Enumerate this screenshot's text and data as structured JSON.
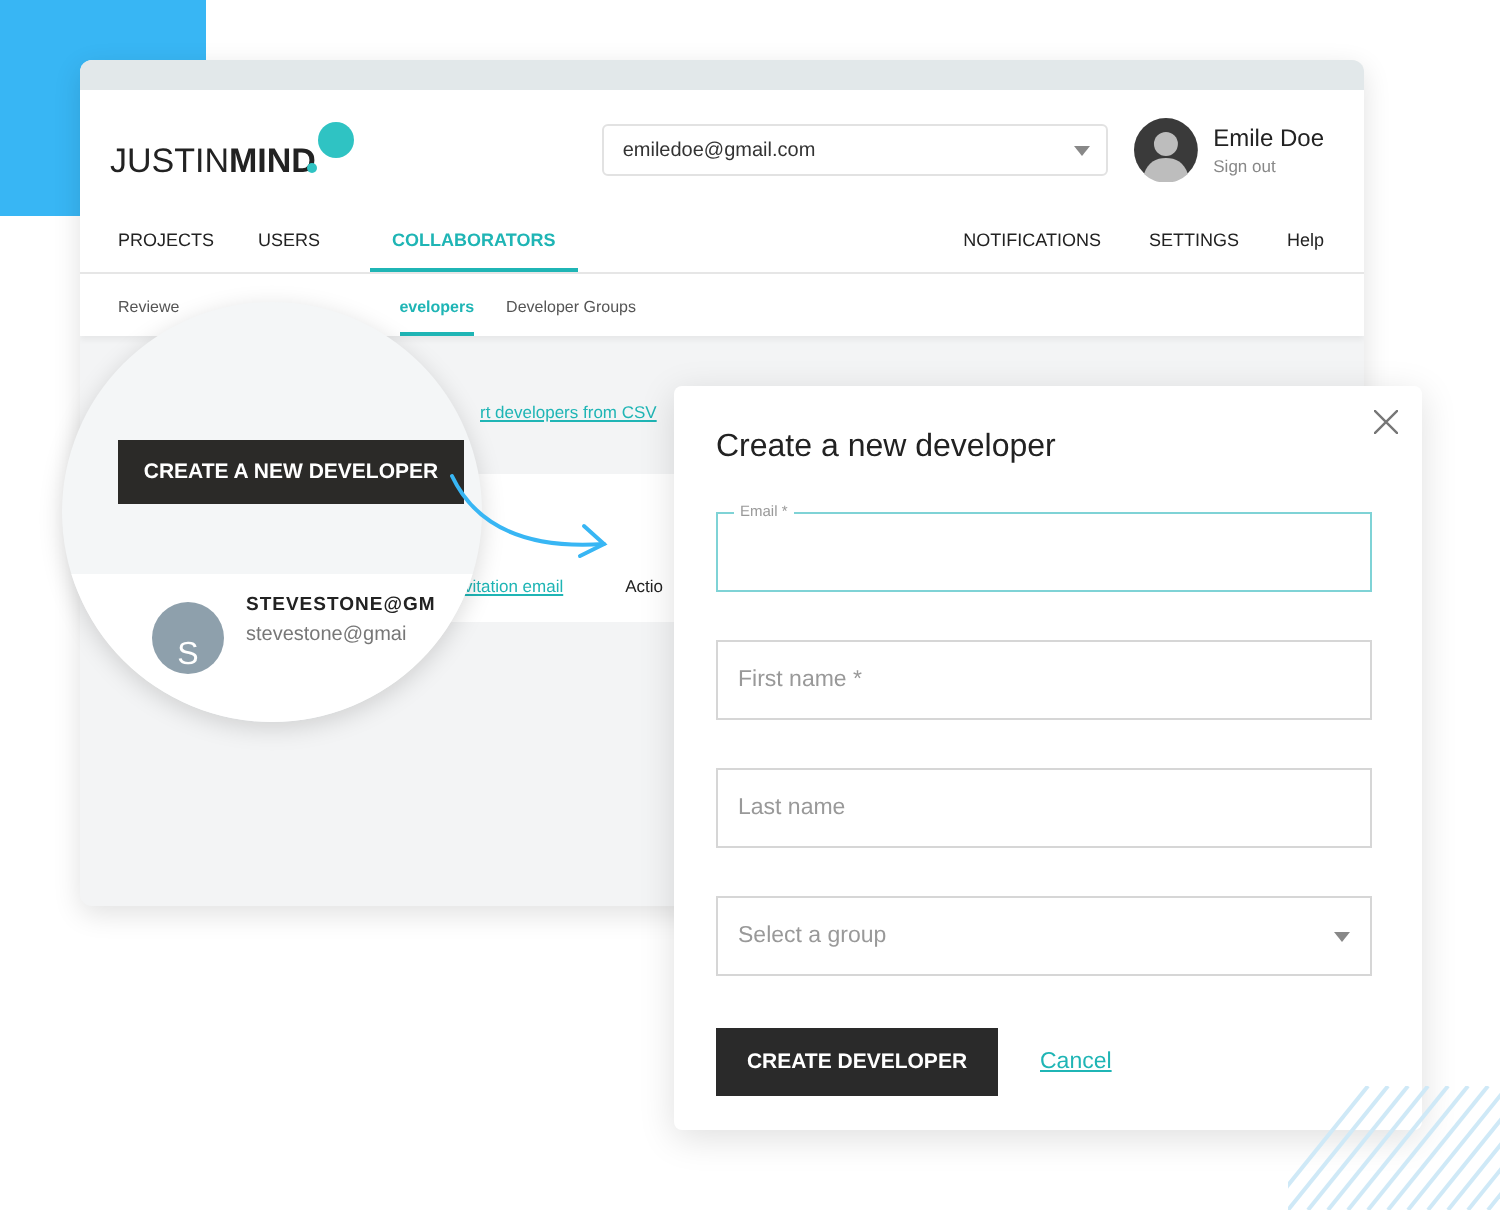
{
  "header": {
    "logo": {
      "light": "JUSTIN",
      "bold": "MIND"
    },
    "account_select": {
      "value": "emiledoe@gmail.com"
    },
    "user": {
      "name": "Emile Doe",
      "sign_out": "Sign out"
    }
  },
  "nav": {
    "left": [
      {
        "label": "PROJECTS",
        "selected": false
      },
      {
        "label": "USERS",
        "selected": false
      },
      {
        "label": "COLLABORATORS",
        "selected": true
      }
    ],
    "right": [
      {
        "label": "NOTIFICATIONS",
        "selected": false
      },
      {
        "label": "SETTINGS",
        "selected": false
      },
      {
        "label": "Help",
        "selected": false
      }
    ]
  },
  "subnav": [
    {
      "label": "Reviewe",
      "selected": false
    },
    {
      "label": "evelopers",
      "selected": true
    },
    {
      "label": "Developer Groups",
      "selected": false
    }
  ],
  "page": {
    "import_link": "rt developers from CSV",
    "invitation_link": "vitation email",
    "actions_label": "Actio"
  },
  "magnifier": {
    "button": "CREATE A NEW DEVELOPER",
    "developer": {
      "initial": "S",
      "name": "STEVESTONE@GM",
      "email": "stevestone@gmai"
    }
  },
  "dialog": {
    "title": "Create a new developer",
    "fields": [
      {
        "kind": "input",
        "label": "Email *",
        "focused": true
      },
      {
        "kind": "input",
        "placeholder": "First name *",
        "focused": false
      },
      {
        "kind": "input",
        "placeholder": "Last name",
        "focused": false
      },
      {
        "kind": "select",
        "placeholder": "Select a group",
        "focused": false
      }
    ],
    "submit": "CREATE DEVELOPER",
    "cancel": "Cancel"
  }
}
